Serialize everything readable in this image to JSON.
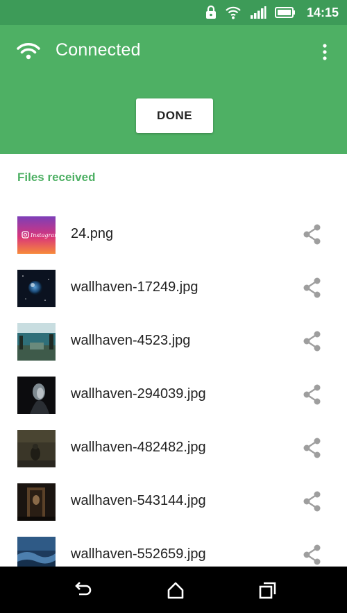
{
  "status_bar": {
    "time": "14:15",
    "icons": [
      "lock-icon",
      "wifi-signal-icon",
      "cell-signal-icon",
      "battery-icon"
    ]
  },
  "header": {
    "title": "Connected",
    "done_label": "DONE",
    "icons": [
      "wifi-icon",
      "more-vert-icon"
    ],
    "background_color": "#4eb064"
  },
  "files": {
    "section_label": "Files received",
    "items": [
      {
        "name": "24.png",
        "thumb": "instagram-image"
      },
      {
        "name": "wallhaven-17249.jpg",
        "thumb": "planet-image"
      },
      {
        "name": "wallhaven-4523.jpg",
        "thumb": "waterfall-image"
      },
      {
        "name": "wallhaven-294039.jpg",
        "thumb": "portrait-image"
      },
      {
        "name": "wallhaven-482482.jpg",
        "thumb": "dark-figure-image"
      },
      {
        "name": "wallhaven-543144.jpg",
        "thumb": "doorway-image"
      },
      {
        "name": "wallhaven-552659.jpg",
        "thumb": "ocean-image"
      }
    ],
    "thumb_text": "Instagram"
  },
  "nav_bar": {
    "icons": [
      "back-icon",
      "home-icon",
      "recents-icon"
    ]
  }
}
